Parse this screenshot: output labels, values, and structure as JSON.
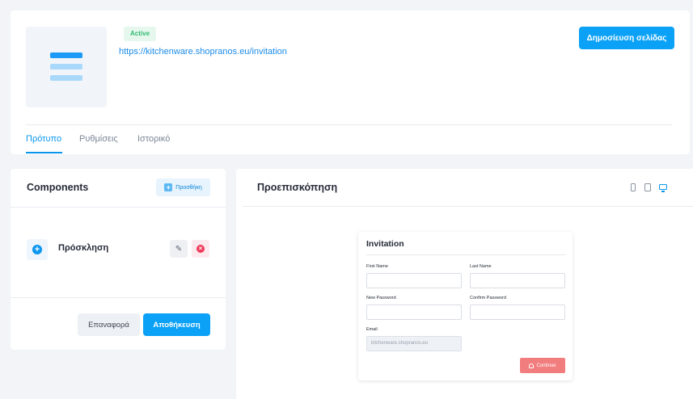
{
  "header": {
    "status_badge": "Active",
    "page_url": "https://kitchenware.shopranos.eu/invitation",
    "publish_label": "Δημοσίευση σελίδας",
    "tabs": [
      {
        "label": "Πρότυπο",
        "active": true
      },
      {
        "label": "Ρυθμίσεις",
        "active": false
      },
      {
        "label": "Ιστορικό",
        "active": false
      }
    ]
  },
  "components": {
    "title": "Components",
    "add_label": "Προσθήκη",
    "items": [
      {
        "name": "Πρόσκληση"
      }
    ],
    "reset_label": "Επαναφορά",
    "save_label": "Αποθήκευση"
  },
  "preview": {
    "title": "Προεπισκόπηση",
    "devices": [
      "mobile-icon",
      "tablet-icon",
      "desktop-icon"
    ],
    "active_device": "desktop",
    "form": {
      "title": "Invitation",
      "first_name_label": "First Name",
      "last_name_label": "Last Name",
      "new_password_label": "New Password",
      "confirm_password_label": "Confirm Password",
      "email_label": "Email",
      "email_value": "kitchenware.shopranos.eu",
      "continue_label": "Continue"
    }
  },
  "colors": {
    "primary": "#0aa1f7",
    "active_badge": "#2fba6d",
    "danger": "#ee3b5b",
    "continue": "#f27d7e"
  }
}
